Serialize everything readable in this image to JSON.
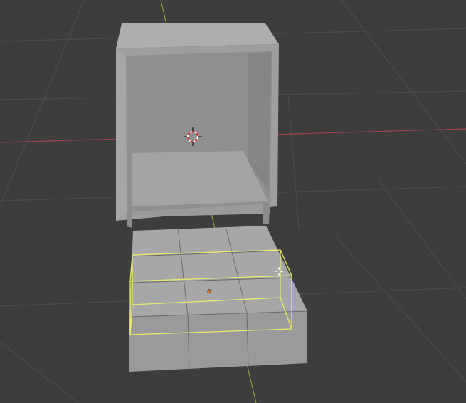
{
  "viewport": {
    "background": "#3d3d3d",
    "grid_color": "#4a4a4a",
    "x_axis_color": "#a3414f",
    "y_axis_color": "#9fa93a",
    "selection_color": "#e8ec6a",
    "object_color": "#9a9a9a"
  },
  "objects": {
    "cabinet": "cabinet-mesh",
    "drawer": "drawer-mesh-selected"
  },
  "icons": {
    "cursor": "3d-cursor-icon",
    "origin": "object-origin-icon",
    "mouse": "crosshair-pointer-icon"
  }
}
